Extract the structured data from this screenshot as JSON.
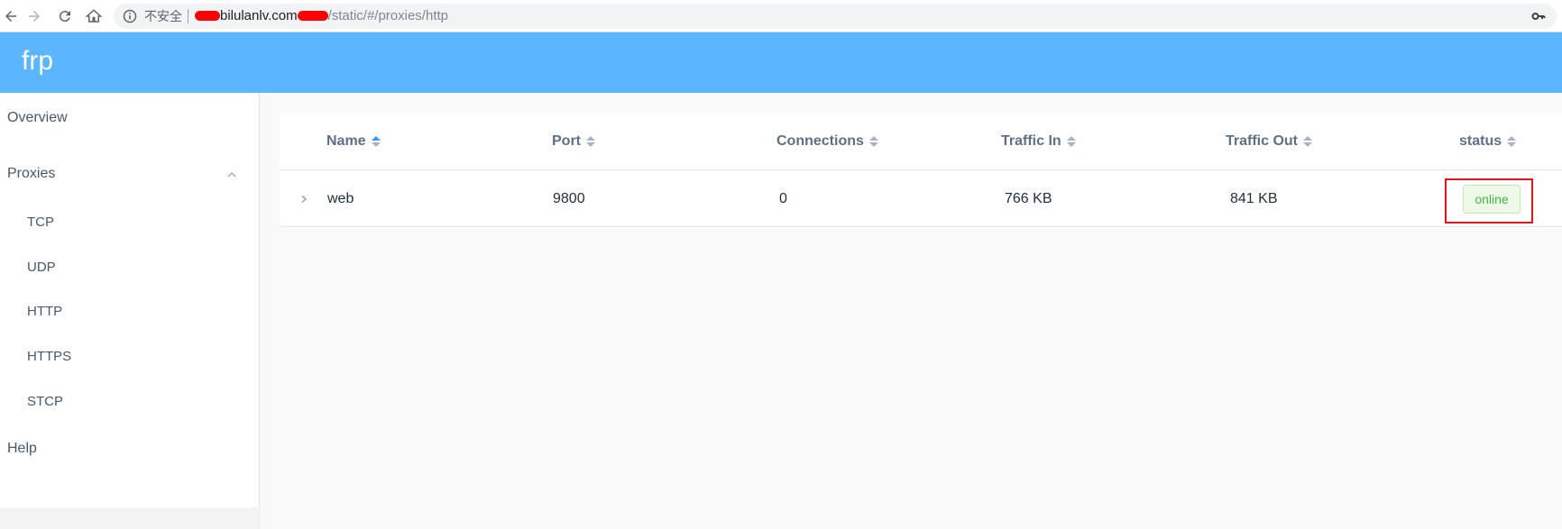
{
  "browser": {
    "security_label": "不安全",
    "url_host": "bilulanlv.com",
    "url_path": "/static/#/proxies/http"
  },
  "app": {
    "brand": "frp"
  },
  "sidebar": {
    "items": [
      {
        "label": "Overview"
      },
      {
        "label": "Proxies",
        "expanded": true,
        "children": [
          {
            "label": "TCP"
          },
          {
            "label": "UDP"
          },
          {
            "label": "HTTP"
          },
          {
            "label": "HTTPS"
          },
          {
            "label": "STCP"
          }
        ]
      },
      {
        "label": "Help"
      }
    ]
  },
  "table": {
    "columns": [
      {
        "label": "Name",
        "sort": "asc"
      },
      {
        "label": "Port"
      },
      {
        "label": "Connections"
      },
      {
        "label": "Traffic In"
      },
      {
        "label": "Traffic Out"
      },
      {
        "label": "status"
      }
    ],
    "rows": [
      {
        "name": "web",
        "port": "9800",
        "connections": "0",
        "traffic_in": "766 KB",
        "traffic_out": "841 KB",
        "status": "online"
      }
    ]
  },
  "colors": {
    "header_bg": "#5cb6ff",
    "status_online_text": "#45b53e",
    "highlight_box": "#e0161c"
  }
}
